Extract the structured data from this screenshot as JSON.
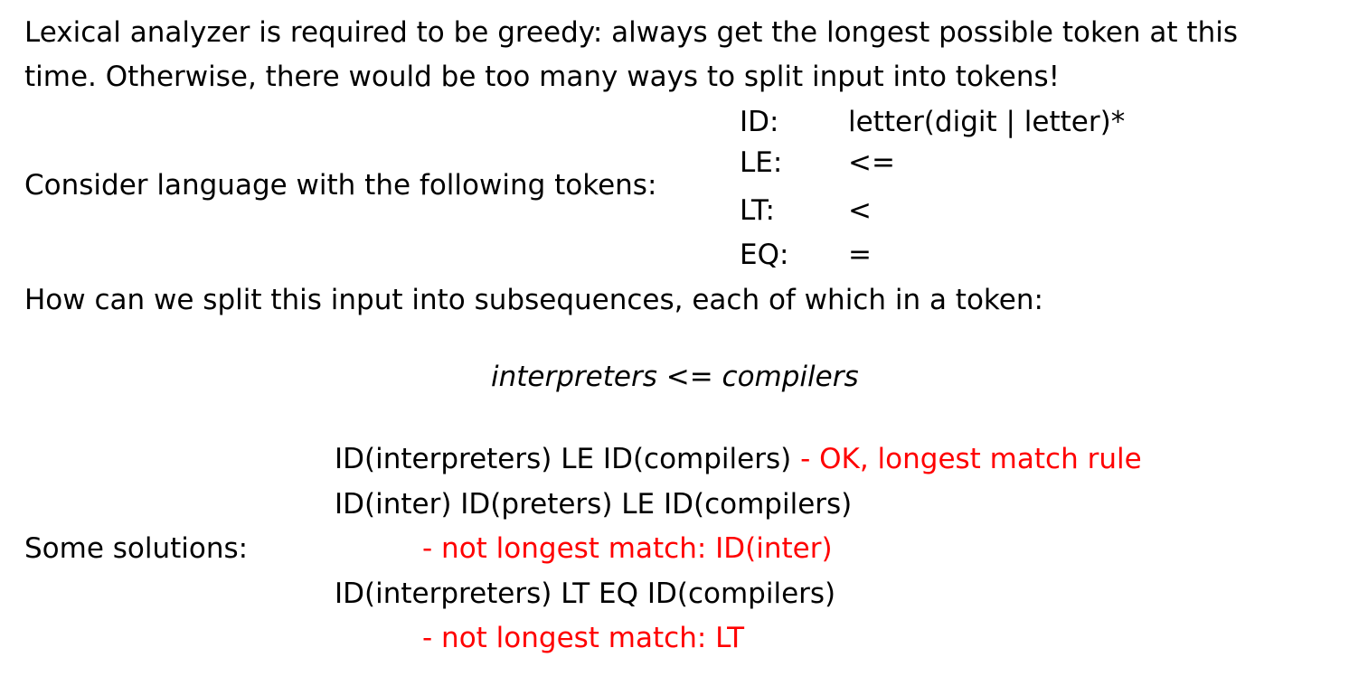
{
  "intro": {
    "line1": "Lexical analyzer is required to be greedy: always get the longest possible token at this",
    "line2": "time. Otherwise, there would be too many ways to split input into tokens!"
  },
  "consider_label": "Consider language with the following tokens:",
  "tokens": [
    {
      "name": "ID:",
      "definition": "letter(digit | letter)*"
    },
    {
      "name": "LE:",
      "definition": "<="
    },
    {
      "name": "LT:",
      "definition": "<"
    },
    {
      "name": "EQ:",
      "definition": "="
    }
  ],
  "question": "How can we split this input into subsequences, each of which in a token:",
  "input_expression": {
    "left": "interpreters",
    "op": "<=",
    "right": "compilers"
  },
  "solutions_label": "Some solutions:",
  "solutions": {
    "s1_main": "ID(interpreters) LE ID(compilers)",
    "s1_note": " - OK, longest match rule",
    "s2_main": "ID(inter) ID(preters) LE ID(compilers)",
    "s2_note": "- not longest match: ID(inter)",
    "s3_main": "ID(interpreters) LT EQ ID(compilers)",
    "s3_note": "- not longest match: LT"
  },
  "colors": {
    "text": "#000000",
    "highlight": "#ff0000",
    "background": "#ffffff"
  }
}
